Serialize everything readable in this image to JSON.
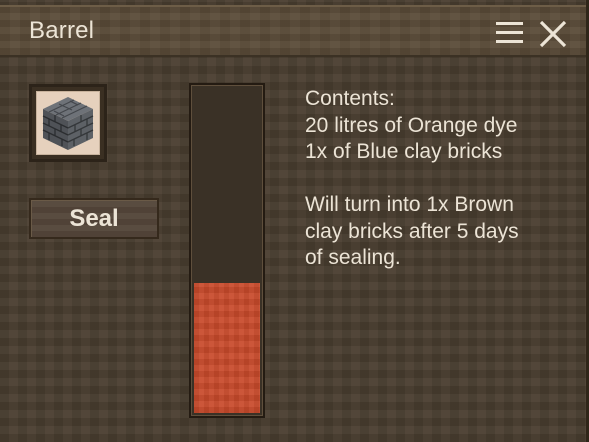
{
  "window": {
    "title": "Barrel",
    "menu_icon": "hamburger-menu-icon",
    "close_icon": "close-icon"
  },
  "input_slot": {
    "item_icon": "blue-clay-bricks-icon"
  },
  "seal_button": {
    "label": "Seal"
  },
  "liquid_gauge": {
    "fill_fraction": 0.4,
    "fill_color": "#c84a2b"
  },
  "info": {
    "heading": "Contents:",
    "liquid_line": "20 litres of Orange dye",
    "item_line": "1x of Blue clay bricks",
    "result_lines": [
      "Will turn into 1x Brown",
      "clay bricks after 5 days",
      "of sealing."
    ]
  }
}
